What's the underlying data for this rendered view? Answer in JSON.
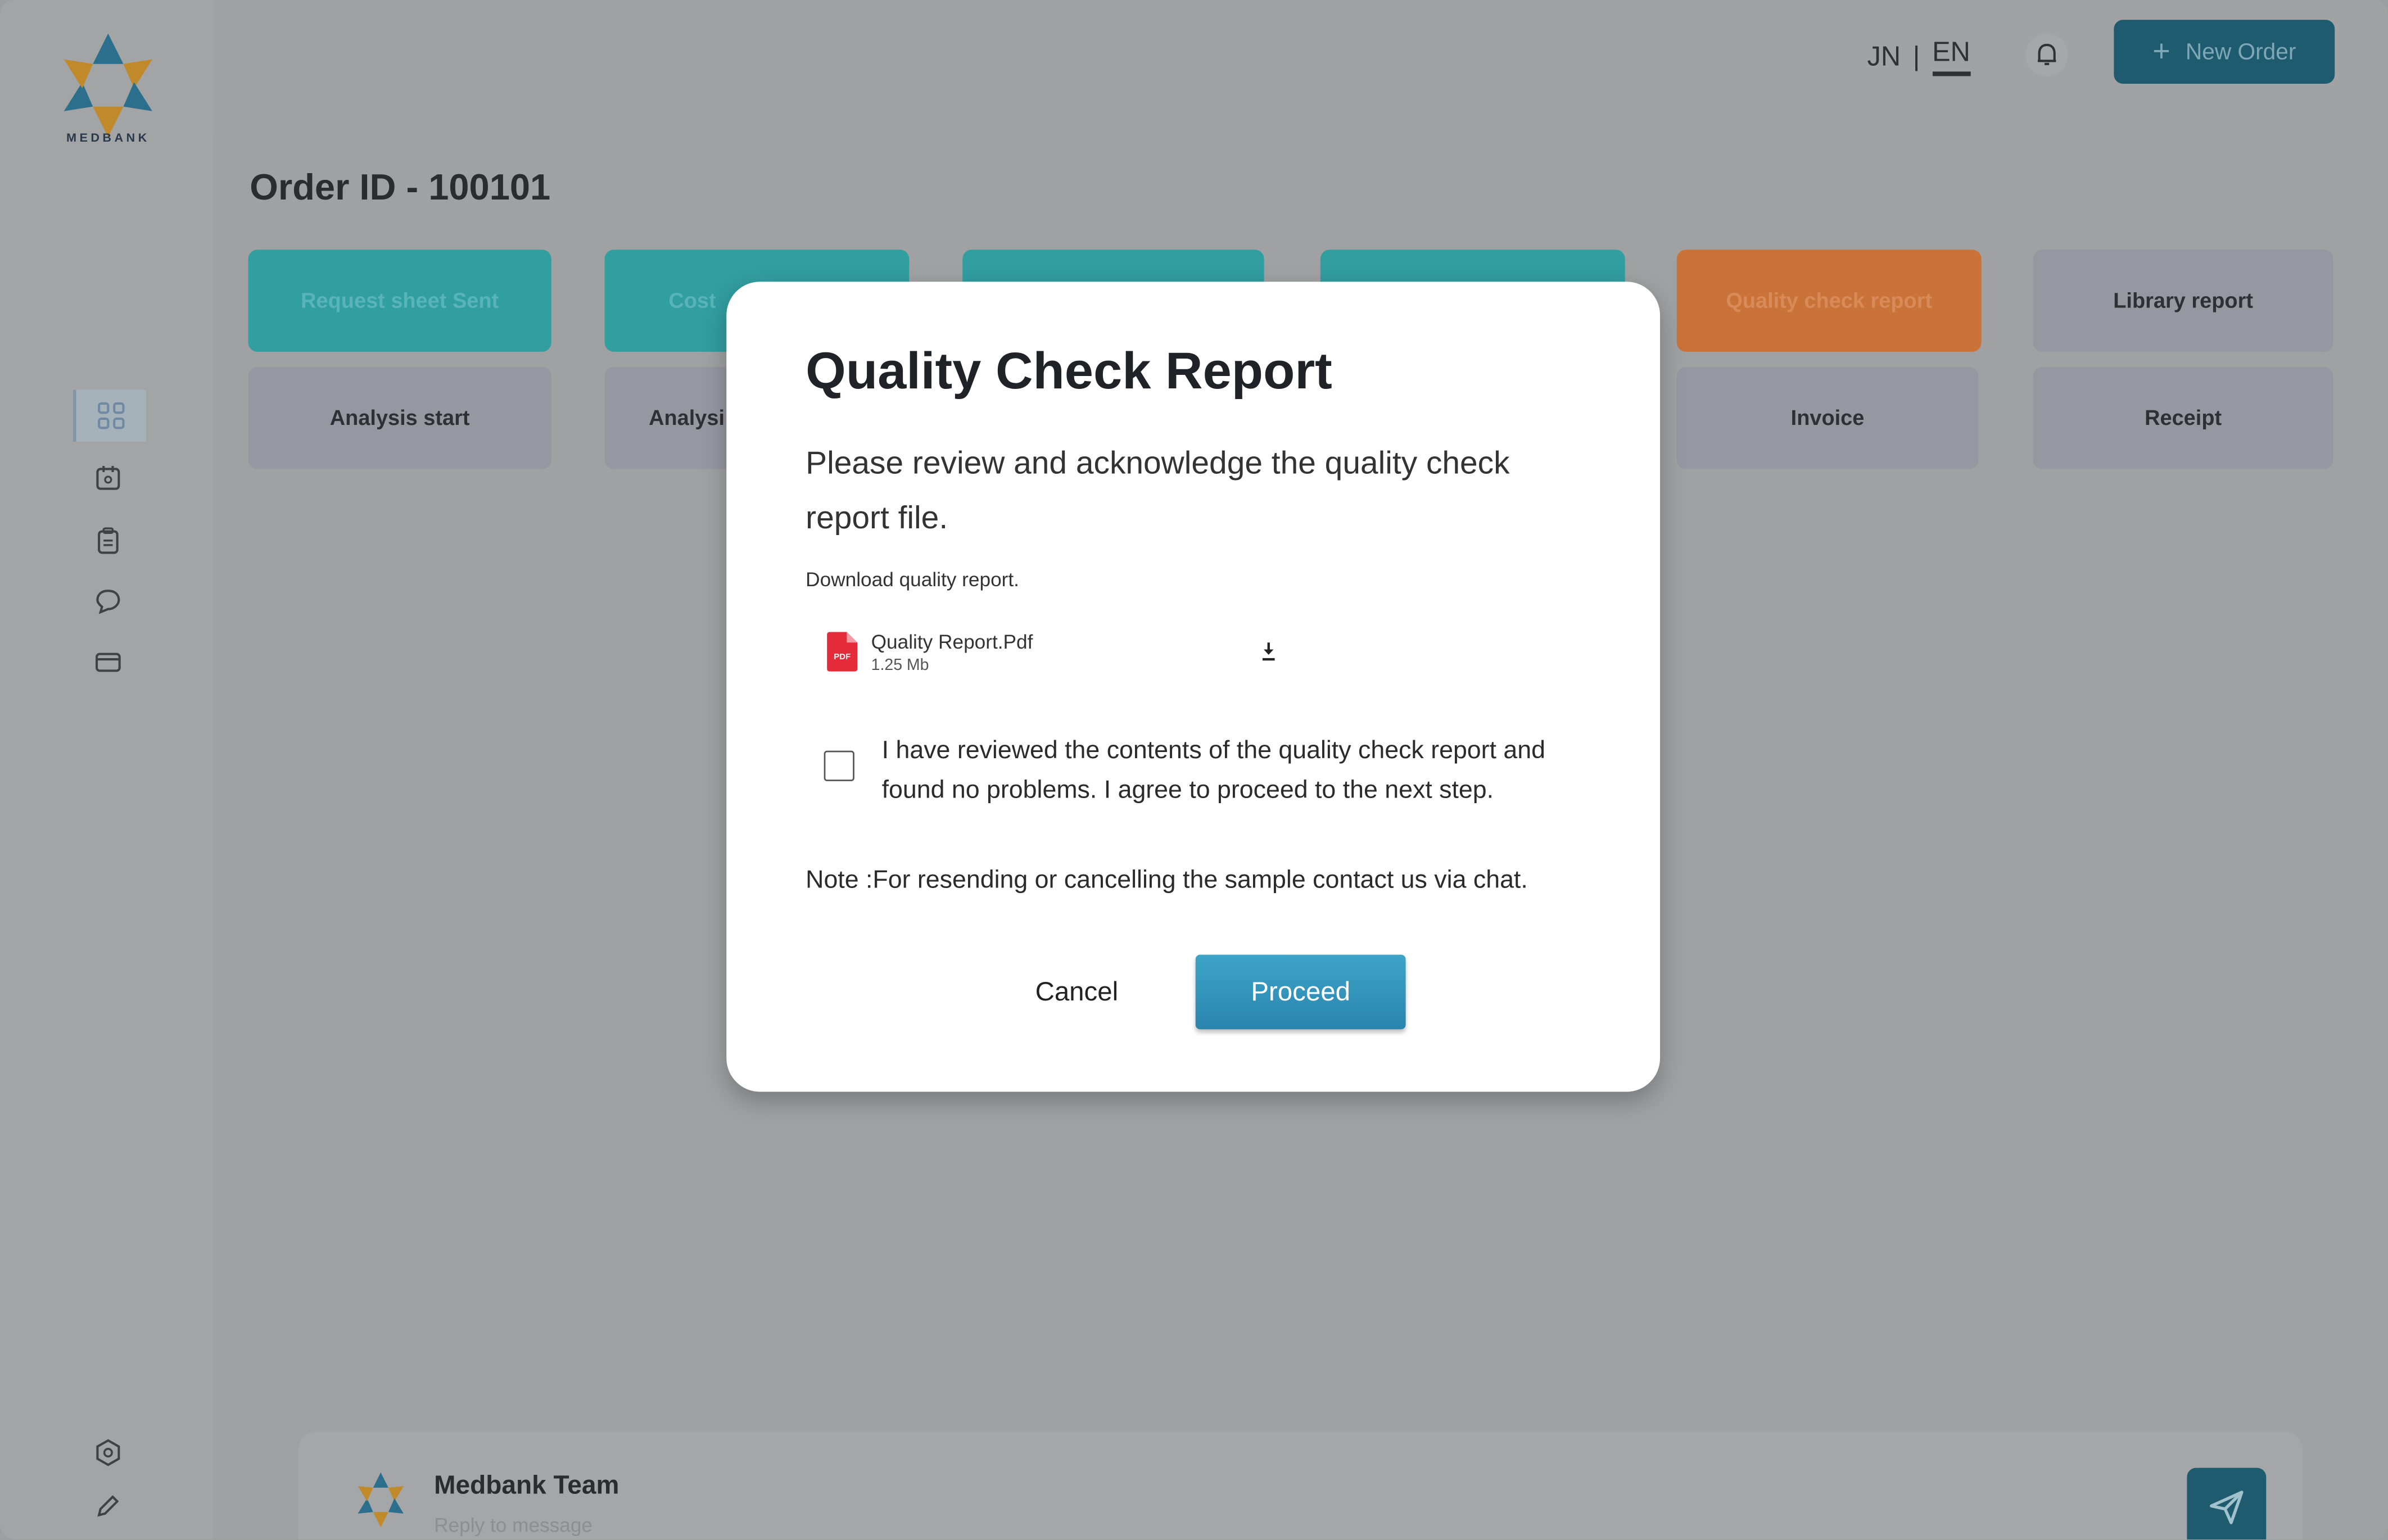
{
  "brand": {
    "logo_text": "MEDBANK"
  },
  "header": {
    "lang_jn": "JN",
    "lang_sep": "|",
    "lang_en": "EN",
    "new_order_label": "New Order",
    "new_order_icon": "+"
  },
  "order": {
    "title": "Order ID - 100101"
  },
  "status_cards": [
    {
      "label": "Request sheet Sent",
      "state": "done"
    },
    {
      "label": "Cost",
      "state": "done"
    },
    {
      "label": "",
      "state": "done"
    },
    {
      "label": "",
      "state": "done"
    },
    {
      "label": "Quality check report",
      "state": "current"
    },
    {
      "label": "Library report",
      "state": "pending"
    },
    {
      "label": "Analysis start",
      "state": "pending"
    },
    {
      "label": "Analysi",
      "state": "pending"
    },
    {
      "label": "Invoice",
      "state": "pending"
    },
    {
      "label": "Receipt",
      "state": "pending"
    }
  ],
  "sidebar": {
    "items": [
      {
        "icon": "grid-icon",
        "active": true
      },
      {
        "icon": "calendar-icon",
        "active": false
      },
      {
        "icon": "clipboard-icon",
        "active": false
      },
      {
        "icon": "chat-icon",
        "active": false
      },
      {
        "icon": "card-icon",
        "active": false
      }
    ],
    "bottom": [
      {
        "icon": "settings-icon"
      },
      {
        "icon": "pen-icon"
      }
    ]
  },
  "chat": {
    "name": "Medbank Team",
    "placeholder": "Reply to message"
  },
  "modal": {
    "title": "Quality Check Report",
    "description": "Please review and acknowledge the quality check report file.",
    "download_label": "Download quality report.",
    "file_name": "Quality Report.Pdf",
    "file_size": "1.25 Mb",
    "pdf_badge": "PDF",
    "checkbox_label": "I have reviewed the contents of the quality check report and found no problems. I agree to proceed to the next step.",
    "checkbox_checked": false,
    "note": "Note :For resending or cancelling the sample contact us via chat.",
    "cancel_label": "Cancel",
    "proceed_label": "Proceed"
  },
  "colors": {
    "accent": "#2f8fb8",
    "teal": "#319ea0",
    "orange": "#ca7338",
    "dark_button": "#1f5b6e",
    "pdf_red": "#e32b3a"
  }
}
